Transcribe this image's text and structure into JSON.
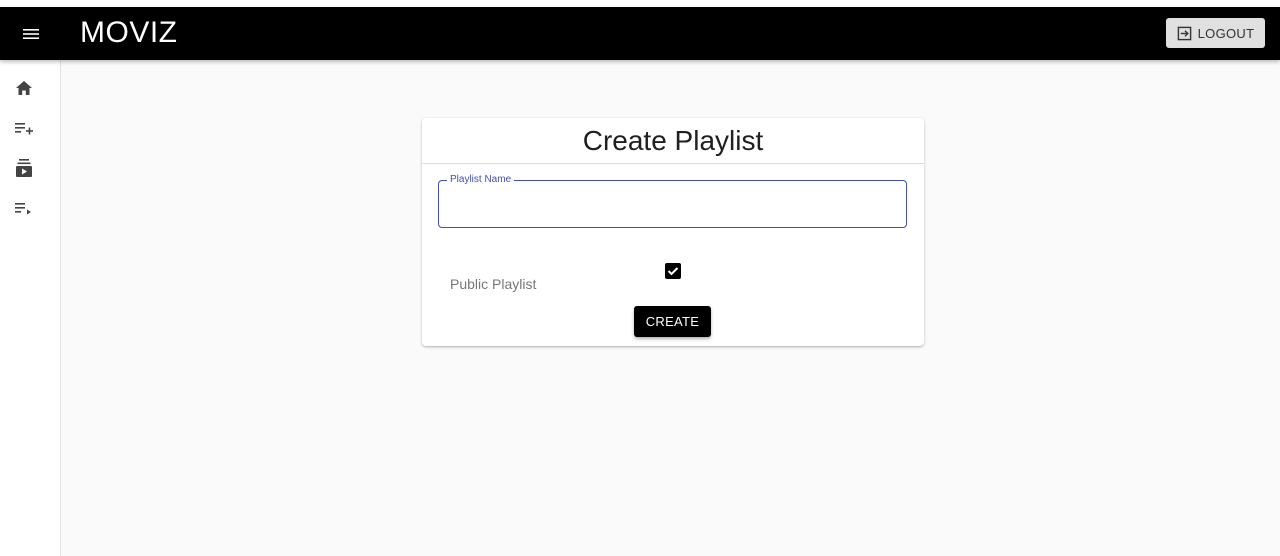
{
  "appbar": {
    "menu_icon": "hamburger-menu-icon",
    "brand": "MOVIZ",
    "logout_label": "LOGOUT",
    "logout_icon": "logout-icon"
  },
  "sidebar": {
    "items": [
      {
        "icon": "home-icon"
      },
      {
        "icon": "playlist-add-icon"
      },
      {
        "icon": "subscriptions-icon"
      },
      {
        "icon": "playlist-play-icon"
      }
    ]
  },
  "card": {
    "title": "Create Playlist",
    "name_field": {
      "label": "Playlist Name",
      "value": ""
    },
    "public_label": "Public Playlist",
    "public_checked": true,
    "create_label": "CREATE"
  },
  "colors": {
    "appbar": "#000000",
    "accent": "#3f51b5",
    "background": "#fafafa"
  }
}
